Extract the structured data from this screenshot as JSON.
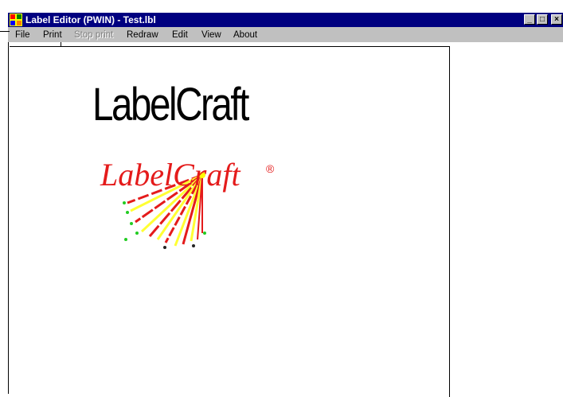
{
  "window": {
    "title": "Label Editor (PWIN) - Test.lbl",
    "controls": {
      "minimize": "_",
      "maximize": "□",
      "close": "×"
    }
  },
  "menu": {
    "file": "File",
    "print": "Print",
    "stop_print": "Stop print",
    "redraw": "Redraw",
    "edit": "Edit",
    "view": "View",
    "about": "About"
  },
  "document": {
    "heading": "LabelCraft",
    "logo_text": "LabelCraft",
    "logo_mark": "®"
  },
  "colors": {
    "titlebar": "#000080",
    "menubar": "#c0c0c0",
    "logo_red": "#e41b1b",
    "logo_yellow": "#ffff33",
    "logo_green": "#22cc22"
  },
  "icons": {
    "app": "label-editor-app-icon",
    "minimize": "minimize-icon",
    "maximize": "maximize-icon",
    "close": "close-icon"
  }
}
